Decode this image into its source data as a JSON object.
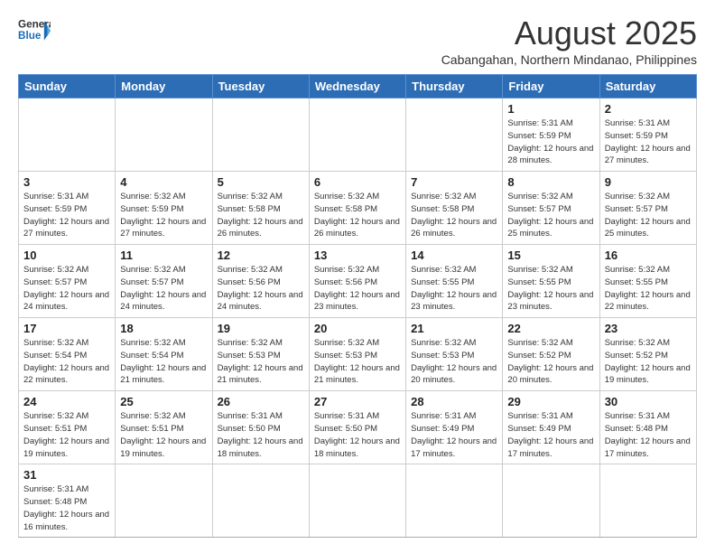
{
  "logo": {
    "text_general": "General",
    "text_blue": "Blue"
  },
  "header": {
    "title": "August 2025",
    "subtitle": "Cabangahan, Northern Mindanao, Philippines"
  },
  "weekdays": [
    "Sunday",
    "Monday",
    "Tuesday",
    "Wednesday",
    "Thursday",
    "Friday",
    "Saturday"
  ],
  "weeks": [
    [
      {
        "day": "",
        "info": ""
      },
      {
        "day": "",
        "info": ""
      },
      {
        "day": "",
        "info": ""
      },
      {
        "day": "",
        "info": ""
      },
      {
        "day": "",
        "info": ""
      },
      {
        "day": "1",
        "info": "Sunrise: 5:31 AM\nSunset: 5:59 PM\nDaylight: 12 hours and 28 minutes."
      },
      {
        "day": "2",
        "info": "Sunrise: 5:31 AM\nSunset: 5:59 PM\nDaylight: 12 hours and 27 minutes."
      }
    ],
    [
      {
        "day": "3",
        "info": "Sunrise: 5:31 AM\nSunset: 5:59 PM\nDaylight: 12 hours and 27 minutes."
      },
      {
        "day": "4",
        "info": "Sunrise: 5:32 AM\nSunset: 5:59 PM\nDaylight: 12 hours and 27 minutes."
      },
      {
        "day": "5",
        "info": "Sunrise: 5:32 AM\nSunset: 5:58 PM\nDaylight: 12 hours and 26 minutes."
      },
      {
        "day": "6",
        "info": "Sunrise: 5:32 AM\nSunset: 5:58 PM\nDaylight: 12 hours and 26 minutes."
      },
      {
        "day": "7",
        "info": "Sunrise: 5:32 AM\nSunset: 5:58 PM\nDaylight: 12 hours and 26 minutes."
      },
      {
        "day": "8",
        "info": "Sunrise: 5:32 AM\nSunset: 5:57 PM\nDaylight: 12 hours and 25 minutes."
      },
      {
        "day": "9",
        "info": "Sunrise: 5:32 AM\nSunset: 5:57 PM\nDaylight: 12 hours and 25 minutes."
      }
    ],
    [
      {
        "day": "10",
        "info": "Sunrise: 5:32 AM\nSunset: 5:57 PM\nDaylight: 12 hours and 24 minutes."
      },
      {
        "day": "11",
        "info": "Sunrise: 5:32 AM\nSunset: 5:57 PM\nDaylight: 12 hours and 24 minutes."
      },
      {
        "day": "12",
        "info": "Sunrise: 5:32 AM\nSunset: 5:56 PM\nDaylight: 12 hours and 24 minutes."
      },
      {
        "day": "13",
        "info": "Sunrise: 5:32 AM\nSunset: 5:56 PM\nDaylight: 12 hours and 23 minutes."
      },
      {
        "day": "14",
        "info": "Sunrise: 5:32 AM\nSunset: 5:55 PM\nDaylight: 12 hours and 23 minutes."
      },
      {
        "day": "15",
        "info": "Sunrise: 5:32 AM\nSunset: 5:55 PM\nDaylight: 12 hours and 23 minutes."
      },
      {
        "day": "16",
        "info": "Sunrise: 5:32 AM\nSunset: 5:55 PM\nDaylight: 12 hours and 22 minutes."
      }
    ],
    [
      {
        "day": "17",
        "info": "Sunrise: 5:32 AM\nSunset: 5:54 PM\nDaylight: 12 hours and 22 minutes."
      },
      {
        "day": "18",
        "info": "Sunrise: 5:32 AM\nSunset: 5:54 PM\nDaylight: 12 hours and 21 minutes."
      },
      {
        "day": "19",
        "info": "Sunrise: 5:32 AM\nSunset: 5:53 PM\nDaylight: 12 hours and 21 minutes."
      },
      {
        "day": "20",
        "info": "Sunrise: 5:32 AM\nSunset: 5:53 PM\nDaylight: 12 hours and 21 minutes."
      },
      {
        "day": "21",
        "info": "Sunrise: 5:32 AM\nSunset: 5:53 PM\nDaylight: 12 hours and 20 minutes."
      },
      {
        "day": "22",
        "info": "Sunrise: 5:32 AM\nSunset: 5:52 PM\nDaylight: 12 hours and 20 minutes."
      },
      {
        "day": "23",
        "info": "Sunrise: 5:32 AM\nSunset: 5:52 PM\nDaylight: 12 hours and 19 minutes."
      }
    ],
    [
      {
        "day": "24",
        "info": "Sunrise: 5:32 AM\nSunset: 5:51 PM\nDaylight: 12 hours and 19 minutes."
      },
      {
        "day": "25",
        "info": "Sunrise: 5:32 AM\nSunset: 5:51 PM\nDaylight: 12 hours and 19 minutes."
      },
      {
        "day": "26",
        "info": "Sunrise: 5:31 AM\nSunset: 5:50 PM\nDaylight: 12 hours and 18 minutes."
      },
      {
        "day": "27",
        "info": "Sunrise: 5:31 AM\nSunset: 5:50 PM\nDaylight: 12 hours and 18 minutes."
      },
      {
        "day": "28",
        "info": "Sunrise: 5:31 AM\nSunset: 5:49 PM\nDaylight: 12 hours and 17 minutes."
      },
      {
        "day": "29",
        "info": "Sunrise: 5:31 AM\nSunset: 5:49 PM\nDaylight: 12 hours and 17 minutes."
      },
      {
        "day": "30",
        "info": "Sunrise: 5:31 AM\nSunset: 5:48 PM\nDaylight: 12 hours and 17 minutes."
      }
    ],
    [
      {
        "day": "31",
        "info": "Sunrise: 5:31 AM\nSunset: 5:48 PM\nDaylight: 12 hours and 16 minutes."
      },
      {
        "day": "",
        "info": ""
      },
      {
        "day": "",
        "info": ""
      },
      {
        "day": "",
        "info": ""
      },
      {
        "day": "",
        "info": ""
      },
      {
        "day": "",
        "info": ""
      },
      {
        "day": "",
        "info": ""
      }
    ]
  ]
}
